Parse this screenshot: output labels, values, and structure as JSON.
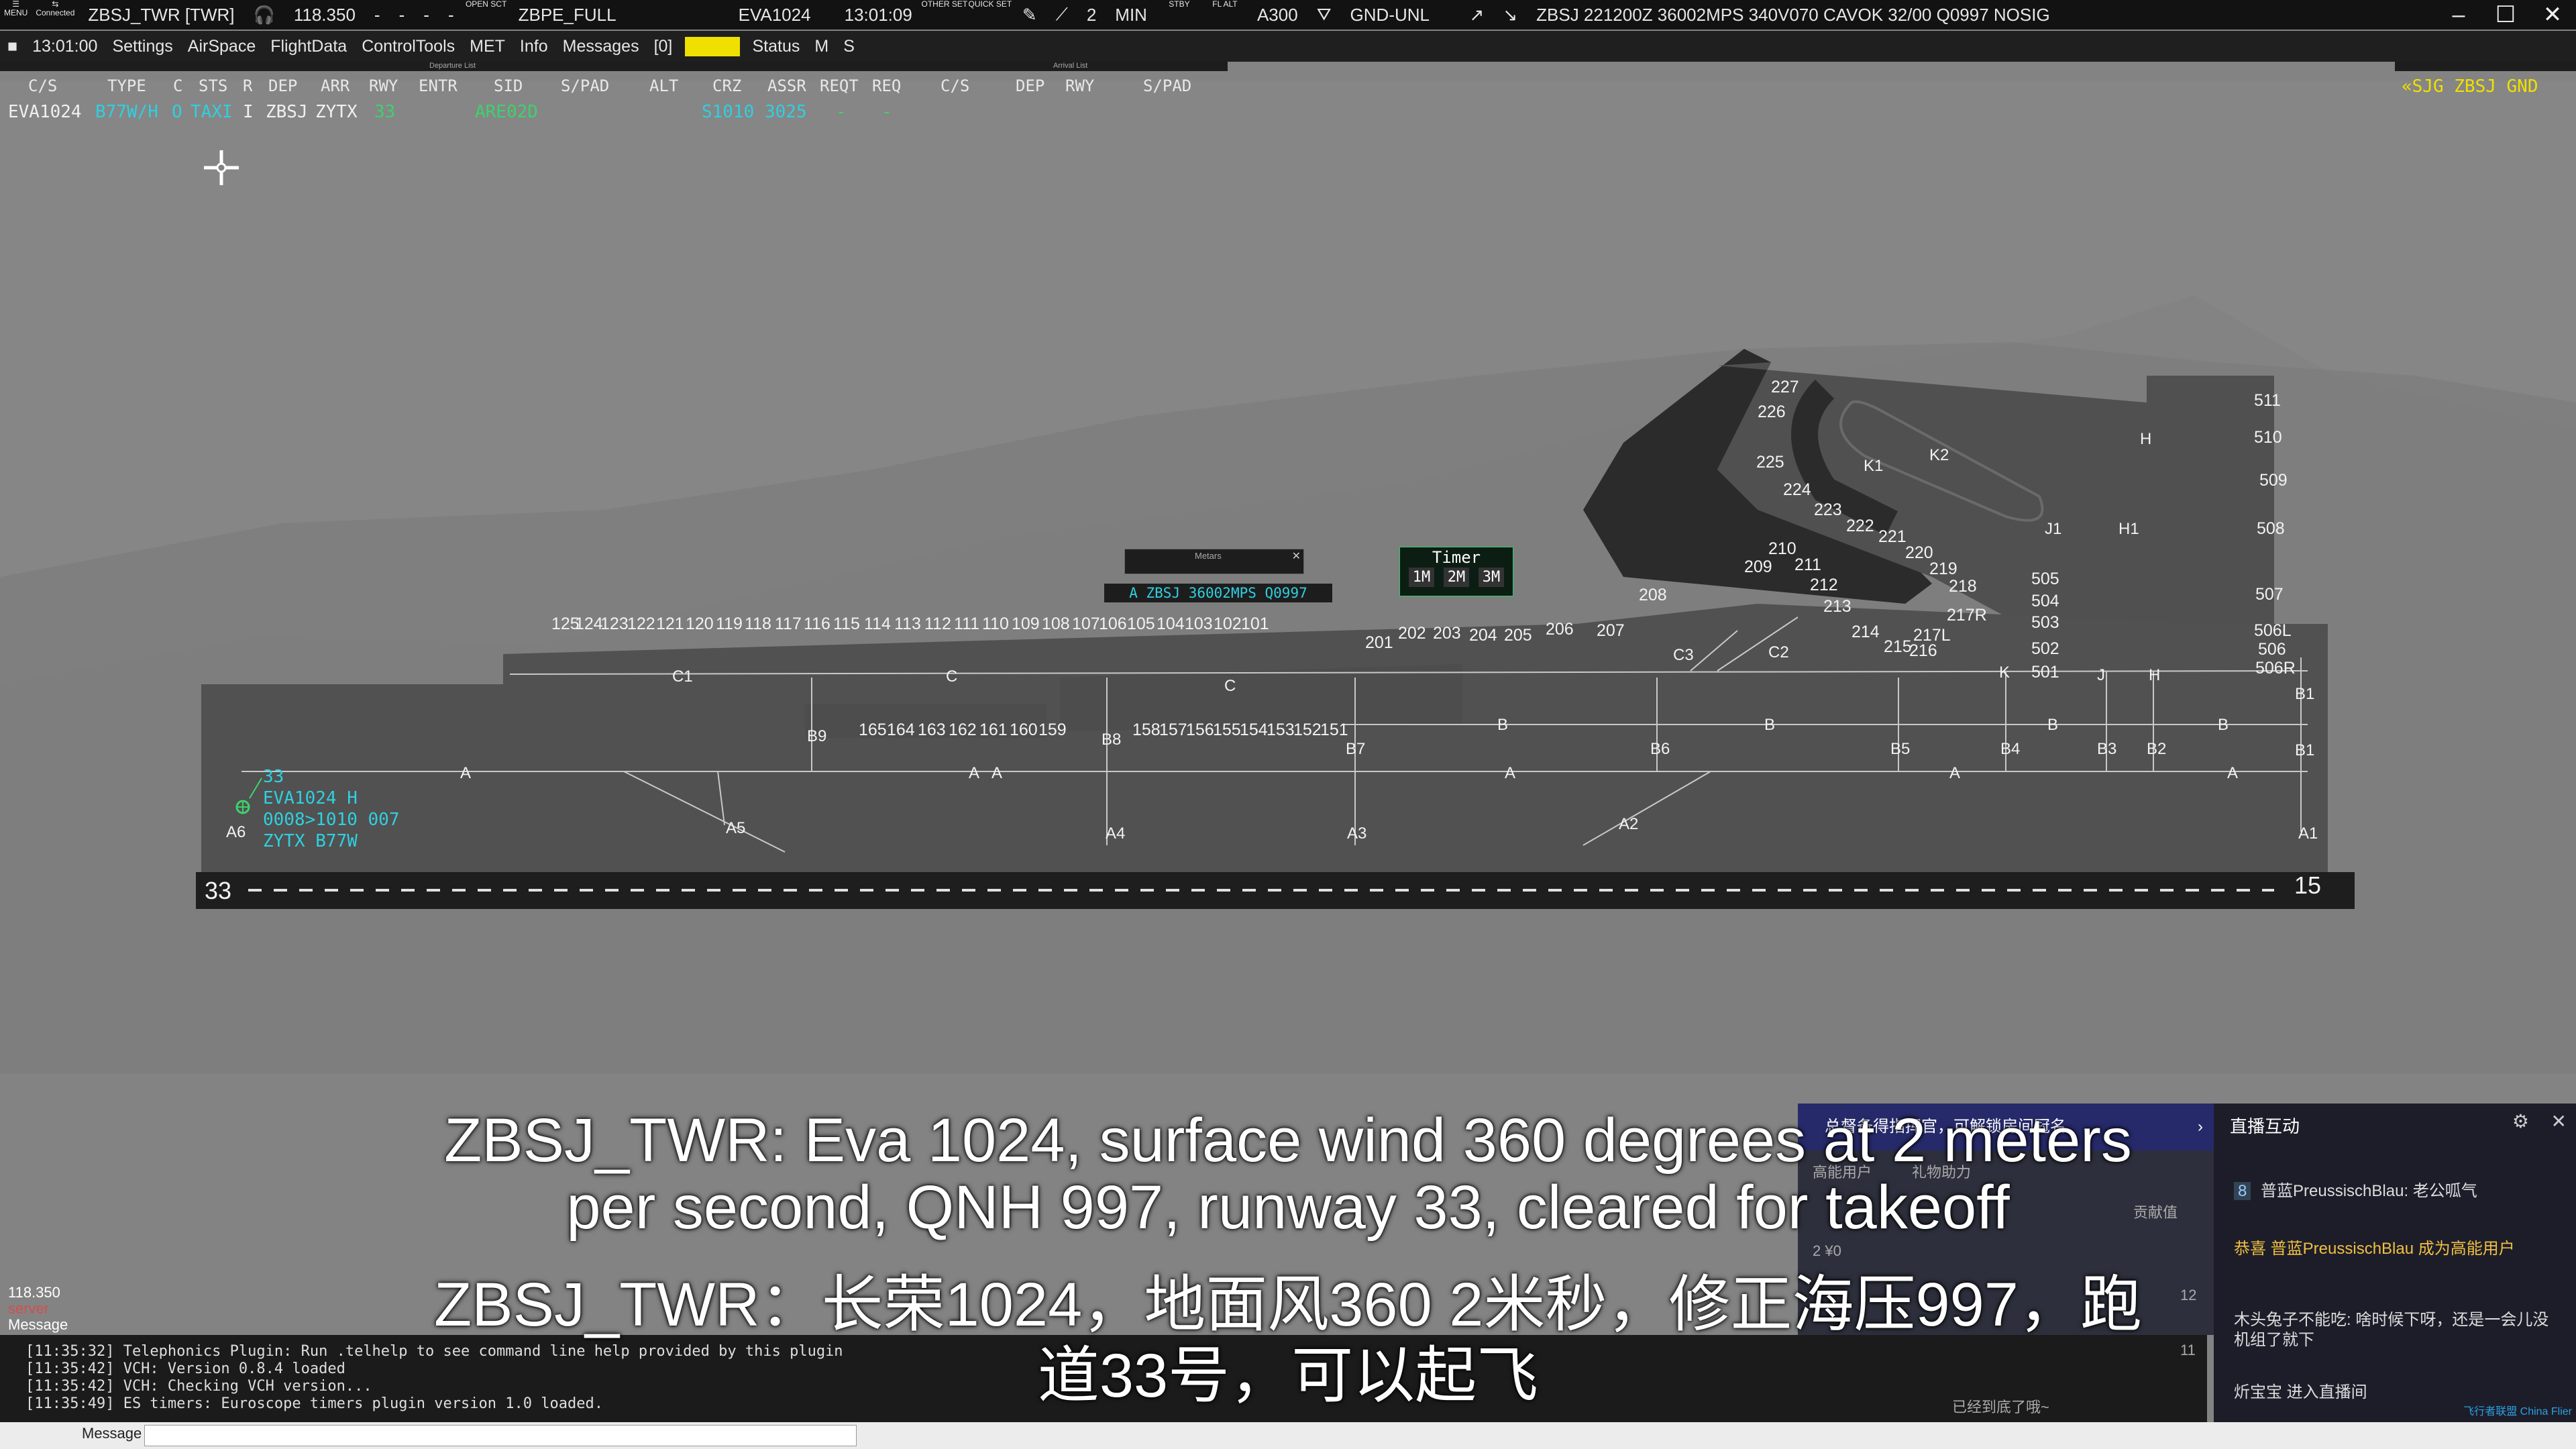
{
  "topbar": {
    "menu_label": "MENU",
    "connected_label": "Connected",
    "callsign": "ZBSJ_TWR [TWR]",
    "frequency": "118.350",
    "dash1": "-",
    "dash2": "-",
    "dash3": "-",
    "dash4": "-",
    "open_sct": "OPEN SCT",
    "sector_file": "ZBPE_FULL",
    "selected_aircraft": "EVA1024",
    "time": "13:01:09",
    "other_set": "OTHER SET",
    "quick_set": "QUICK SET",
    "timer_value": "2",
    "timer_unit": "MIN",
    "stby": "STBY",
    "fl_alt": "FL ALT",
    "aircraft_type": "A300",
    "alt_filter": "GND-UNL",
    "metar": "ZBSJ 221200Z 36002MPS 340V070 CAVOK 32/00 Q0997 NOSIG"
  },
  "menubar": {
    "clock": "13:01:00",
    "items": [
      "Settings",
      "AirSpace",
      "FlightData",
      "ControlTools",
      "MET",
      "Info",
      "Messages",
      "[0]"
    ],
    "highlight": "ZBSJ",
    "status": "Status",
    "m": "M",
    "s": "S"
  },
  "departure_list": {
    "title": "Departure List",
    "headers": [
      "C/S",
      "TYPE",
      "C",
      "STS",
      "R",
      "DEP",
      "ARR",
      "RWY",
      "ENTR",
      "SID",
      "S/PAD",
      "ALT",
      "CRZ",
      "ASSR",
      "REQT",
      "REQ"
    ],
    "row": {
      "cs": "EVA1024",
      "type": "B77W/H",
      "c": "O",
      "sts": "TAXI",
      "r": "I",
      "dep": "ZBSJ",
      "arr": "ZYTX",
      "rwy": "33",
      "sid": "ARE02D",
      "crz": "S1010",
      "assr": "3025",
      "reqt": "-",
      "req": "-"
    }
  },
  "arrival_list": {
    "title": "Arrival List",
    "headers": [
      "C/S",
      "DEP",
      "RWY",
      "S/PAD"
    ]
  },
  "atis_label": "«SJG ZBSJ GND",
  "metars_window": {
    "title": "Metars",
    "text": "A ZBSJ 36002MPS Q0997"
  },
  "timer_window": {
    "title": "Timer",
    "buttons": [
      "1M",
      "2M",
      "3M"
    ]
  },
  "aircraft_tag": {
    "runway": "33",
    "callsign": "EVA1024 H",
    "squawk": "0008>1010 007",
    "dest_type": "ZYTX B77W"
  },
  "runway": {
    "left_label": "33",
    "right_label": "15"
  },
  "stands_row1": [
    "125",
    "124",
    "123",
    "122",
    "121",
    "120",
    "119",
    "118",
    "117",
    "116",
    "115",
    "114",
    "113",
    "112",
    "111",
    "110",
    "109",
    "108",
    "107",
    "106",
    "105",
    "104",
    "103",
    "102",
    "101"
  ],
  "stands_row2": [
    "165",
    "164",
    "163",
    "162",
    "161",
    "160",
    "159"
  ],
  "stands_row3": [
    "158",
    "157",
    "156",
    "155",
    "154",
    "153",
    "152",
    "151"
  ],
  "stands_row4": [
    "201",
    "202",
    "203",
    "204",
    "205",
    "206",
    "207"
  ],
  "stands_misc": [
    "227",
    "226",
    "225",
    "224",
    "223",
    "222",
    "221",
    "220",
    "219",
    "218",
    "217R",
    "217L",
    "216",
    "215",
    "214",
    "213",
    "212",
    "211",
    "210",
    "209",
    "208",
    "511",
    "510",
    "509",
    "508",
    "507",
    "506L",
    "506",
    "506R",
    "505",
    "504",
    "503",
    "502",
    "501"
  ],
  "taxiways": [
    "C1",
    "C",
    "C",
    "B9",
    "B8",
    "B7",
    "B",
    "B",
    "B",
    "B",
    "B6",
    "B5",
    "B4",
    "B3",
    "B2",
    "B1",
    "B1",
    "A",
    "A",
    "A",
    "A",
    "A",
    "A",
    "A6",
    "A5",
    "A4",
    "A3",
    "A2",
    "A1",
    "C3",
    "C2",
    "K1",
    "K2",
    "J1",
    "H1",
    "H",
    "K",
    "J",
    "H"
  ],
  "subtitle": {
    "en_line1": "ZBSJ_TWR: Eva 1024, surface wind 360 degrees at 2 meters",
    "en_line2": "per second, QNH 997, runway 33, cleared for takeoff",
    "zh_line1": "ZBSJ_TWR：长荣1024，地面风360 2米秒，修正海压997，跑",
    "zh_line2": "道33号，可以起飞"
  },
  "side_status": {
    "freq": "118.350",
    "server": "server",
    "message": "Message"
  },
  "log_lines": [
    "[11:35:32] Telephonics Plugin: Run .telhelp to see command line help provided by this plugin",
    "[11:35:42] VCH: Version 0.8.4 loaded",
    "[11:35:42] VCH: Checking VCH version...",
    "[11:35:49] ES timers: Euroscope timers plugin version 1.0 loaded."
  ],
  "message_label": "Message",
  "live_panel": {
    "title": "直播互动",
    "banner": "总督备得指挥官，可解锁房间冠名",
    "high_user": "高能用户",
    "gift_list": "礼物助力",
    "contrib": "贡献值",
    "count": "2  ¥0",
    "num12": "12",
    "num11": "11",
    "msg1_level": "8",
    "msg1": "普蓝PreussischBlau: 老公呱气",
    "msg2": "恭喜 普蓝PreussischBlau 成为高能用户",
    "msg3": "木头兔子不能吃: 啥时候下呀，还是一会儿没机组了就下",
    "msg4": "炘宝宝 进入直播间",
    "footer": "已经到底了哦~",
    "watermark": "飞行者联盟 China Flier"
  }
}
